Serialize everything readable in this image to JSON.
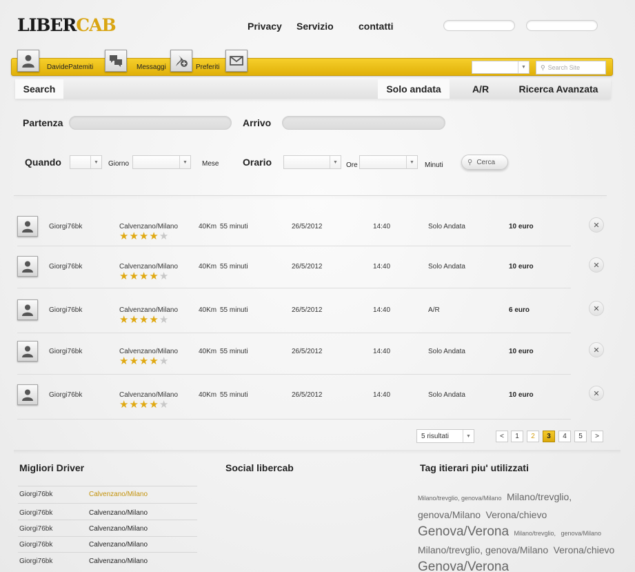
{
  "header": {
    "logo_dark": "LIBER",
    "logo_gold": "CAB",
    "nav": [
      "Privacy",
      "Servizio",
      "contatti"
    ]
  },
  "toolbar": {
    "user": "DavidePatemiti",
    "messages": "Messaggi",
    "favorites": "Preferiti",
    "select_value": "",
    "search_placeholder": "Search Site"
  },
  "tabs": {
    "search": "Search",
    "one_way": "Solo andata",
    "round_trip": "A/R",
    "advanced": "Ricerca Avanzata"
  },
  "form": {
    "from_label": "Partenza",
    "to_label": "Arrivo",
    "when_label": "Quando",
    "day_label": "Giorno",
    "month_label": "Mese",
    "time_label": "Orario",
    "hours_label": "Ore",
    "minutes_label": "Minuti",
    "search_button": "Cerca"
  },
  "results": [
    {
      "user": "Giorgi76bk",
      "route": "Calvenzano/Milano",
      "km": "40Km",
      "duration": "55 minuti",
      "date": "26/5/2012",
      "time": "14:40",
      "type": "Solo Andata",
      "price": "10 euro",
      "rating": 4
    },
    {
      "user": "Giorgi76bk",
      "route": "Calvenzano/Milano",
      "km": "40Km",
      "duration": "55 minuti",
      "date": "26/5/2012",
      "time": "14:40",
      "type": "Solo Andata",
      "price": "10 euro",
      "rating": 4
    },
    {
      "user": "Giorgi76bk",
      "route": "Calvenzano/Milano",
      "km": "40Km",
      "duration": "55 minuti",
      "date": "26/5/2012",
      "time": "14:40",
      "type": "A/R",
      "price": "6 euro",
      "rating": 4
    },
    {
      "user": "Giorgi76bk",
      "route": "Calvenzano/Milano",
      "km": "40Km",
      "duration": "55 minuti",
      "date": "26/5/2012",
      "time": "14:40",
      "type": "Solo Andata",
      "price": "10 euro",
      "rating": 4
    },
    {
      "user": "Giorgi76bk",
      "route": "Calvenzano/Milano",
      "km": "40Km",
      "duration": "55 minuti",
      "date": "26/5/2012",
      "time": "14:40",
      "type": "Solo Andata",
      "price": "10 euro",
      "rating": 4
    }
  ],
  "pagination": {
    "results_select": "5 risultati",
    "pages": [
      "1",
      "2",
      "3",
      "4",
      "5"
    ],
    "current": "3",
    "prev": "<",
    "next": ">"
  },
  "best_drivers": {
    "title": "Migliori Driver",
    "rows": [
      {
        "name": "Giorgi76bk",
        "route": "Calvenzano/Milano",
        "highlight": true
      },
      {
        "name": "Giorgi76bk",
        "route": "Calvenzano/Milano",
        "highlight": false
      },
      {
        "name": "Giorgi76bk",
        "route": "Calvenzano/Milano",
        "highlight": false
      },
      {
        "name": "Giorgi76bk",
        "route": "Calvenzano/Milano",
        "highlight": false
      },
      {
        "name": "Giorgi76bk",
        "route": "Calvenzano/Milano",
        "highlight": false
      }
    ]
  },
  "social": {
    "title": "Social libercab"
  },
  "tags": {
    "title": "Tag itierari piu' utilizzati",
    "items": [
      {
        "text": "Milano/trevglio, genova/Milano",
        "size": 9
      },
      {
        "text": "Milano/trevglio,",
        "size": 14
      },
      {
        "text": "genova/Milano",
        "size": 14
      },
      {
        "text": "Verona/chievo",
        "size": 14
      },
      {
        "text": "Genova/Verona",
        "size": 19
      },
      {
        "text": "Milano/trevglio,",
        "size": 9
      },
      {
        "text": "genova/Milano",
        "size": 9
      },
      {
        "text": "Milano/trevglio, genova/Milano",
        "size": 14
      },
      {
        "text": "Verona/chievo",
        "size": 14
      },
      {
        "text": "Genova/Verona",
        "size": 19
      }
    ]
  },
  "colors": {
    "accent": "#e8bb12",
    "gold_text": "#c3920b"
  }
}
